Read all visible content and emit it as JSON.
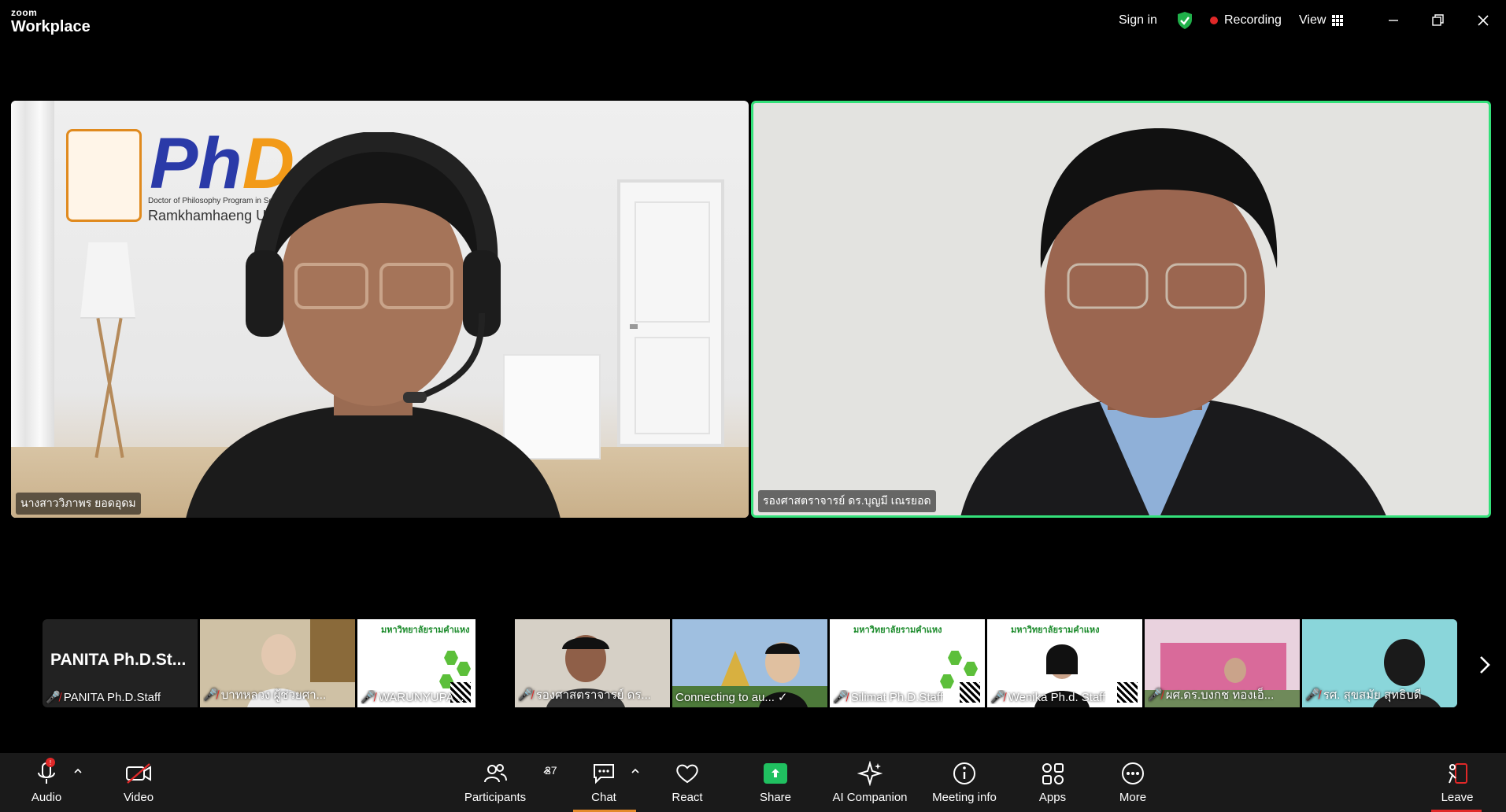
{
  "app": {
    "brand_top": "zoom",
    "brand_main": "Workplace"
  },
  "titlebar": {
    "sign_in": "Sign in",
    "recording": "Recording",
    "view": "View"
  },
  "colors": {
    "active_speaker": "#34e07a",
    "recording_dot": "#e02828",
    "share": "#20c060"
  },
  "main_tiles": [
    {
      "name": "นางสาววิภาพร ยอดอุดม"
    },
    {
      "name": "รองศาสตราจารย์ ดร.บุญมี เณรยอด"
    }
  ],
  "background_logo": {
    "phd": "PhD",
    "line1": "Doctor of Philosophy Program in Soc",
    "line2": "Ramkhamhaeng Uni"
  },
  "thumbnails": [
    {
      "big_name": "PANITA  Ph.D.St...",
      "name": "PANITA Ph.D.Staff",
      "muted": true
    },
    {
      "name": "บาทหลวง ผู้ช่วยศา...",
      "muted": true
    },
    {
      "name": "WARUNYUPA Ph...",
      "muted": true,
      "slide_title": "มหาวิทยาลัยรามคำแหง"
    },
    {
      "name": "รองศาสตราจารย์ ดร...",
      "muted": true
    },
    {
      "name": "Connecting to au...",
      "muted": false
    },
    {
      "name": "Silimat Ph.D.Staff",
      "muted": true,
      "slide_title": "มหาวิทยาลัยรามคำแหง"
    },
    {
      "name": "Wenika Ph.d. Staff",
      "muted": true,
      "slide_title": "มหาวิทยาลัยรามคำแหง"
    },
    {
      "name": "ผศ.ดร.บงกช ทองเอ็...",
      "muted": true
    },
    {
      "name": "รศ. สุขสมัย สุทธิบดี",
      "muted": true
    }
  ],
  "toolbar": {
    "audio": "Audio",
    "video": "Video",
    "participants": "Participants",
    "participants_count": "27",
    "chat": "Chat",
    "react": "React",
    "share": "Share",
    "ai_companion": "AI Companion",
    "meeting_info": "Meeting info",
    "apps": "Apps",
    "more": "More",
    "leave": "Leave",
    "audio_badge": "!"
  }
}
